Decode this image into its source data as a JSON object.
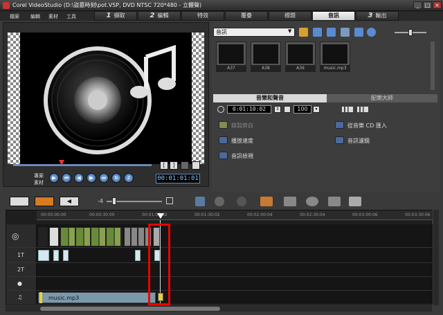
{
  "window": {
    "title": "Corel VideoStudio (D:\\盜墓時刻\\pot.VSP, DVD NTSC 720*480 - 立體聲)",
    "controls": [
      "_",
      "□",
      "×"
    ]
  },
  "menu": [
    "檔案",
    "編輯",
    "素材",
    "工具"
  ],
  "steps": [
    {
      "num": "1",
      "label": "擷取"
    },
    {
      "num": "2",
      "label": "編輯"
    },
    {
      "num": "",
      "label": "特效"
    },
    {
      "num": "",
      "label": "覆疊"
    },
    {
      "num": "",
      "label": "標題"
    },
    {
      "num": "",
      "label": "音訊",
      "active": true
    },
    {
      "num": "3",
      "label": "輸出"
    }
  ],
  "preview": {
    "mode_labels": [
      "專案",
      "素材"
    ],
    "timecode": "00:01:01:01"
  },
  "library": {
    "dropdown": "音訊",
    "thumbs": [
      "A37",
      "A38",
      "A39",
      "music.mp3"
    ]
  },
  "tabs": [
    "音樂和聲音",
    "配樂大師"
  ],
  "audio": {
    "timecode": "0:01:10:02",
    "volume": "100"
  },
  "options": [
    {
      "label": "錄製旁白",
      "disabled": true
    },
    {
      "label": "從音樂 CD 匯入",
      "disabled": false
    },
    {
      "label": "播放速度",
      "disabled": false
    },
    {
      "label": "音訊濾鏡",
      "disabled": false
    },
    {
      "label": "音訊檢視",
      "disabled": false
    }
  ],
  "ruler": [
    "00:00:00:00",
    "00:00:30:00",
    "00:01:00:02",
    "00:01:30:02",
    "00:02:00:04",
    "00:02:30:04",
    "00:03:00:06",
    "00:03:30:06"
  ],
  "tracks": [
    {
      "label": "",
      "icon": "film-icon"
    },
    {
      "label": "1T",
      "icon": ""
    },
    {
      "label": "2T",
      "icon": ""
    },
    {
      "label": "",
      "icon": "voice-icon"
    },
    {
      "label": "♫",
      "icon": "music-icon"
    }
  ],
  "music_clip": "music.mp3",
  "zoom": "-4"
}
